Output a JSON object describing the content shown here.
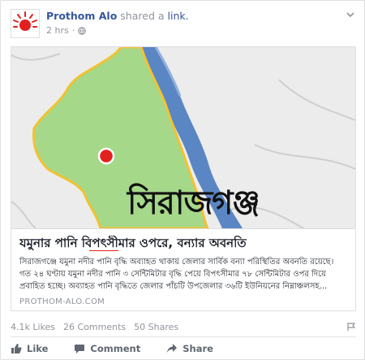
{
  "post": {
    "page_name": "Prothom Alo",
    "shared_text": "shared a",
    "link_word": "link.",
    "time": "2 hrs",
    "privacy_icon": "globe-icon",
    "menu_icon": "chevron-down-icon"
  },
  "link": {
    "map_label": "সিরাজগঞ্জ",
    "title": "যমুনার পানি বিপৎসীমার ওপরে, বন্যার অবনতি",
    "description": "সিরাজগঞ্জে যমুনা নদীর পানি বৃদ্ধি অব্যাহত থাকায় জেলার সার্বিক বন্যা পরিস্থিতির অবনতি রয়েছে। গত ২৪ ঘণ্টায় যমুনা নদীর পানি ৩ সেন্টিমিটার বৃদ্ধি পেয়ে বিপৎসীমার ৭৮ সেন্টিমিটার ওপর দিয়ে প্রবাহিত হচ্ছে। অব্যাহত পানি বৃদ্ধিতে জেলার পাঁচটি উপজেলার ৩৬টি ইউনিয়নের নিম্নাঞ্চলসহ...",
    "domain": "PROTHOM-ALO.COM"
  },
  "stats": {
    "likes": "4.1k Likes",
    "comments": "26 Comments",
    "shares": "50 Shares"
  },
  "actions": {
    "like": "Like",
    "comment": "Comment",
    "share": "Share"
  },
  "colors": {
    "link_blue": "#365899",
    "meta_gray": "#90949c",
    "map_district": "#a6d88a",
    "map_river": "#5b86c4",
    "marker_red": "#e32020"
  }
}
